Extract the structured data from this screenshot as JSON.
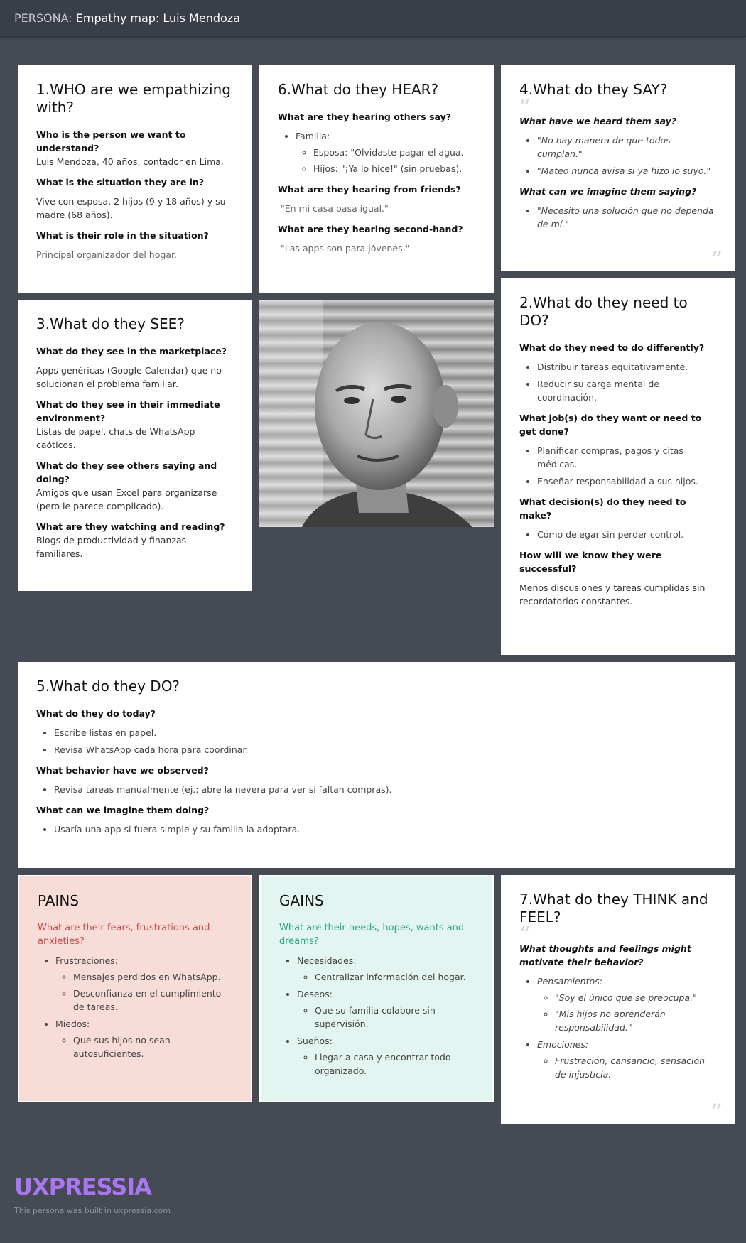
{
  "header": {
    "prefix": "PERSONA:",
    "title": "Empathy map: Luis Mendoza"
  },
  "who": {
    "title": "1.WHO are we empathizing with?",
    "q1": "Who is the person we want to understand?",
    "a1": "Luis Mendoza, 40 años, contador en Lima.",
    "q2": "What is the situation they are in?",
    "a2": "Vive con esposa, 2 hijos (9 y 18 años) y su madre (68 años).",
    "q3": "What is their role in the situation?",
    "a3": "Principal organizador del hogar."
  },
  "hear": {
    "title": "6.What do they HEAR?",
    "q1": "What are they hearing others say?",
    "familia_label": "Familia:",
    "familia_items": [
      "Esposa: \"Olvidaste pagar el agua.",
      "Hijos: \"¡Ya lo hice!\" (sin pruebas)."
    ],
    "q2": "What are they hearing from friends?",
    "a2": "\"En mi casa pasa igual.\"",
    "q3": "What are they hearing second-hand?",
    "a3": "\"Las apps son para jóvenes.\""
  },
  "say": {
    "title": "4.What do they SAY?",
    "q1": "What have we heard them say?",
    "items1": [
      "\"No hay manera de que todos cumplan.\"",
      "\"Mateo nunca avisa si ya hizo lo suyo.\""
    ],
    "q2": "What can we imagine them saying?",
    "items2": [
      "\"Necesito una solución que no dependa de mí.\""
    ],
    "quote_open": "“",
    "quote_close": "”"
  },
  "see": {
    "title": "3.What do they SEE?",
    "q1": "What do they see in the marketplace?",
    "a1": "Apps genéricas (Google Calendar) que no solucionan el problema familiar.",
    "q2": "What do they see in their immediate environment?",
    "a2": "Listas de papel, chats de WhatsApp caóticos.",
    "q3": "What do they see others saying and doing?",
    "a3": "Amigos que usan Excel para organizarse (pero le parece complicado).",
    "q4": "What are they watching and reading?",
    "a4": "Blogs de productividad y finanzas familiares."
  },
  "need": {
    "title": "2.What do they need to DO?",
    "q1": "What do they need to do differently?",
    "items1": [
      "Distribuir tareas equitativamente.",
      "Reducir su carga mental de coordinación."
    ],
    "q2": "What job(s) do they want or need to get done?",
    "items2": [
      "Planificar compras, pagos y citas médicas.",
      "Enseñar responsabilidad a sus hijos."
    ],
    "q3": "What decision(s) do they need to make?",
    "items3": [
      "Cómo delegar sin perder control."
    ],
    "q4": "How will we know they were successful?",
    "a4": "Menos discusiones y tareas cumplidas sin recordatorios constantes."
  },
  "do": {
    "title": "5.What do they DO?",
    "q1": "What do they do today?",
    "items1": [
      "Escribe listas en papel.",
      "Revisa WhatsApp cada hora para coordinar."
    ],
    "q2": "What behavior have we observed?",
    "items2": [
      "Revisa tareas manualmente (ej.: abre la nevera para ver si faltan compras)."
    ],
    "q3": "What can we imagine them doing?",
    "items3": [
      "Usaría una app si fuera simple y su familia la adoptara."
    ]
  },
  "pains": {
    "title": "PAINS",
    "sub": "What are their fears, frustrations and anxieties?",
    "g1": "Frustraciones:",
    "g1_items": [
      "Mensajes perdidos en WhatsApp.",
      "Desconfianza en el cumplimiento de tareas."
    ],
    "g2": "Miedos:",
    "g2_items": [
      "Que sus hijos no sean autosuficientes."
    ]
  },
  "gains": {
    "title": "GAINS",
    "sub": "What are their needs, hopes, wants and dreams?",
    "g1": "Necesidades:",
    "g1_items": [
      "Centralizar información del hogar."
    ],
    "g2": "Deseos:",
    "g2_items": [
      "Que su familia colabore sin supervisión."
    ],
    "g3": "Sueños:",
    "g3_items": [
      "Llegar a casa y encontrar todo organizado."
    ]
  },
  "think": {
    "title": "7.What do they THINK and FEEL?",
    "q1": "What thoughts and feelings might motivate their behavior?",
    "g1": "Pensamientos:",
    "g1_items": [
      "\"Soy el único que se preocupa.\"",
      "\"Mis hijos no aprenderán responsabilidad.\""
    ],
    "g2": "Emociones:",
    "g2_items": [
      "Frustración, cansancio, sensación de injusticia."
    ],
    "quote_open": "“",
    "quote_close": "”"
  },
  "footer": {
    "logo": "UXPRESSIA",
    "note": "This persona was built in uxpressia.com"
  }
}
